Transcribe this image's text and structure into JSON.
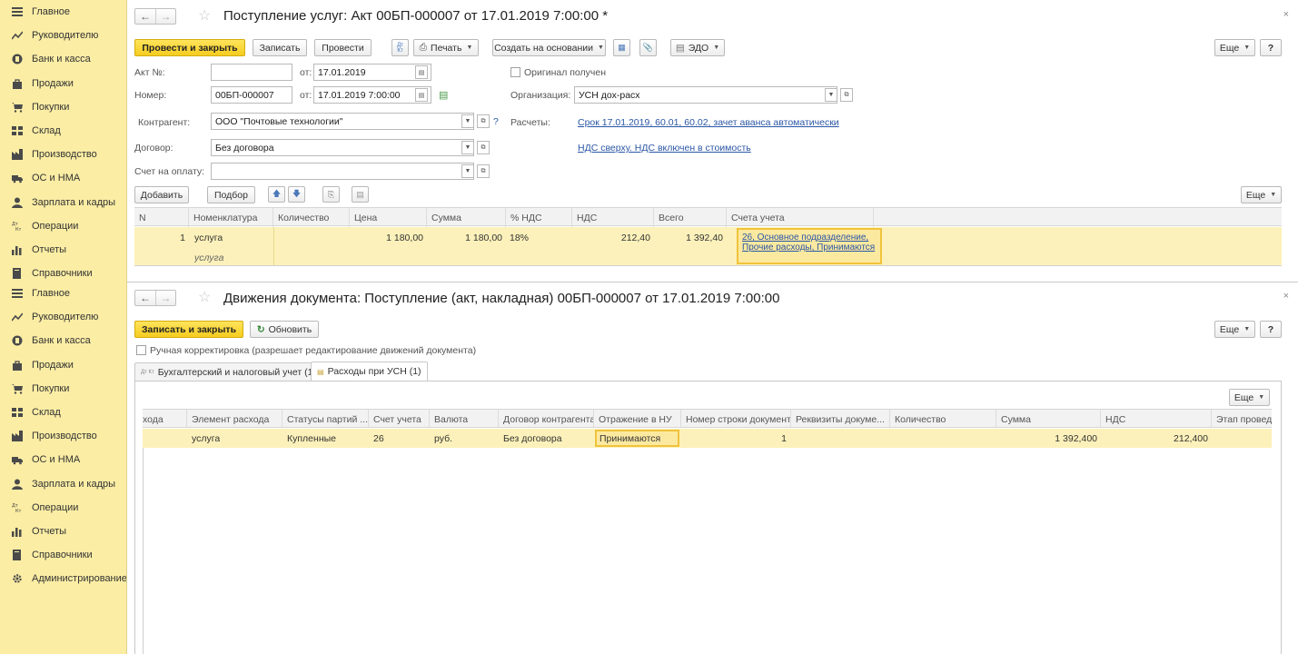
{
  "sidebar_top": [
    {
      "label": "Главное",
      "icon": "menu-icon"
    },
    {
      "label": "Руководителю",
      "icon": "trend-icon"
    },
    {
      "label": "Банк и касса",
      "icon": "coin-icon"
    },
    {
      "label": "Продажи",
      "icon": "bag-icon"
    },
    {
      "label": "Покупки",
      "icon": "cart-icon"
    },
    {
      "label": "Склад",
      "icon": "warehouse-icon"
    },
    {
      "label": "Производство",
      "icon": "factory-icon"
    },
    {
      "label": "ОС и НМА",
      "icon": "truck-icon"
    },
    {
      "label": "Зарплата и кадры",
      "icon": "person-icon"
    },
    {
      "label": "Операции",
      "icon": "dt-kt-icon"
    },
    {
      "label": "Отчеты",
      "icon": "bar-chart-icon"
    },
    {
      "label": "Справочники",
      "icon": "book-icon"
    }
  ],
  "sidebar_bottom": [
    {
      "label": "Главное",
      "icon": "menu-icon"
    },
    {
      "label": "Руководителю",
      "icon": "trend-icon"
    },
    {
      "label": "Банк и касса",
      "icon": "coin-icon"
    },
    {
      "label": "Продажи",
      "icon": "bag-icon"
    },
    {
      "label": "Покупки",
      "icon": "cart-icon"
    },
    {
      "label": "Склад",
      "icon": "warehouse-icon"
    },
    {
      "label": "Производство",
      "icon": "factory-icon"
    },
    {
      "label": "ОС и НМА",
      "icon": "truck-icon"
    },
    {
      "label": "Зарплата и кадры",
      "icon": "person-icon"
    },
    {
      "label": "Операции",
      "icon": "dt-kt-icon"
    },
    {
      "label": "Отчеты",
      "icon": "bar-chart-icon"
    },
    {
      "label": "Справочники",
      "icon": "book-icon"
    },
    {
      "label": "Администрирование",
      "icon": "gear-icon"
    }
  ],
  "doc": {
    "title": "Поступление услуг: Акт 00БП-000007 от 17.01.2019 7:00:00 *",
    "toolbar": {
      "post_close": "Провести и закрыть",
      "save": "Записать",
      "post": "Провести",
      "dt_kt": "Дт Кт",
      "print": "Печать",
      "create_based": "Создать на основании",
      "edo": "ЭДО",
      "more": "Еще",
      "help": "?"
    },
    "fields": {
      "akt_label": "Акт №:",
      "akt_value": "",
      "from_label": "от:",
      "akt_date": "17.01.2019",
      "original_label": "Оригинал получен",
      "number_label": "Номер:",
      "number_value": "00БП-000007",
      "number_date": "17.01.2019  7:00:00",
      "org_label": "Организация:",
      "org_value": "УСН дох-расх",
      "counterparty_label": "Контрагент:",
      "counterparty_value": "ООО \"Почтовые  технологии\"",
      "settlements_label": "Расчеты:",
      "settlements_link": "Срок 17.01.2019, 60.01, 60.02, зачет аванса автоматически",
      "contract_label": "Договор:",
      "contract_value": "Без договора",
      "vat_link": "НДС сверху. НДС включен в стоимость",
      "invoice_label": "Счет на оплату:",
      "invoice_value": "",
      "question": "?"
    },
    "table_toolbar": {
      "add": "Добавить",
      "pick": "Подбор",
      "more": "Еще"
    },
    "columns": [
      "N",
      "Номенклатура",
      "Количество",
      "Цена",
      "Сумма",
      "% НДС",
      "НДС",
      "Всего",
      "Счета учета"
    ],
    "row": {
      "n": "1",
      "item": "услуга",
      "item_sub": "услуга",
      "qty": "",
      "price": "1 180,00",
      "sum": "1 180,00",
      "vat_rate": "18%",
      "vat": "212,40",
      "total": "1 392,40",
      "accounts_line1": "26, Основное подразделение,",
      "accounts_line2": "Прочие расходы, Принимаются"
    }
  },
  "movements": {
    "title": "Движения документа: Поступление (акт, накладная) 00БП-000007 от 17.01.2019 7:00:00",
    "save_close": "Записать и закрыть",
    "refresh": "Обновить",
    "more": "Еще",
    "help": "?",
    "manual_label": "Ручная корректировка (разрешает редактирование движений документа)",
    "tabs": [
      {
        "label": "Бухгалтерский и налоговый учет (1)",
        "icon": "Дт Кт"
      },
      {
        "label": "Расходы при УСН (1)",
        "icon": "▤"
      }
    ],
    "grid_more": "Еще",
    "columns": [
      "хода",
      "Элемент расхода",
      "Статусы партий ...",
      "Счет учета",
      "Валюта",
      "Договор контрагента",
      "Отражение в НУ",
      "Номер строки документа",
      "Реквизиты докуме...",
      "Количество",
      "Сумма",
      "НДС",
      "Этап провед"
    ],
    "row": [
      "",
      "услуга",
      "Купленные",
      "26",
      "руб.",
      "Без договора",
      "Принимаются",
      "1",
      "",
      "",
      "1 392,400",
      "212,400",
      ""
    ]
  },
  "colors": {
    "sidebar": "#fbeda4",
    "primary_button": "#f5cc1e",
    "selected_row": "#fcf1ba",
    "link": "#2a56a5"
  }
}
